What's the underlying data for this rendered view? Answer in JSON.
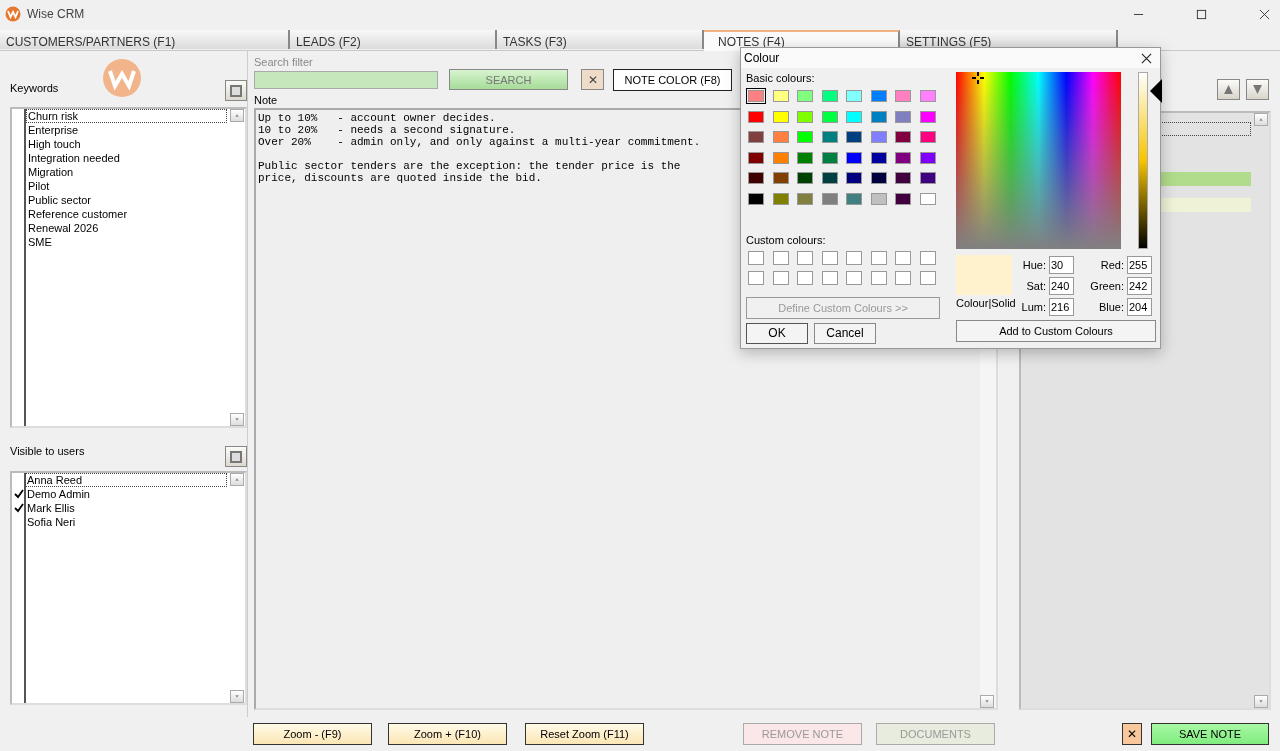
{
  "window": {
    "title": "Wise CRM"
  },
  "tabs": [
    {
      "label": "CUSTOMERS/PARTNERS (F1)",
      "selected": false
    },
    {
      "label": "LEADS (F2)",
      "selected": false
    },
    {
      "label": "TASKS (F3)",
      "selected": false
    },
    {
      "label": "NOTES (F4)",
      "selected": true
    },
    {
      "label": "SETTINGS (F5)",
      "selected": false
    }
  ],
  "keywords": {
    "label": "Keywords",
    "items": [
      {
        "label": "Churn risk",
        "focused": true
      },
      {
        "label": "Enterprise",
        "focused": false
      },
      {
        "label": "High touch",
        "focused": false
      },
      {
        "label": "Integration needed",
        "focused": false
      },
      {
        "label": "Migration",
        "focused": false
      },
      {
        "label": "Pilot",
        "focused": false
      },
      {
        "label": "Public sector",
        "focused": false
      },
      {
        "label": "Reference customer",
        "focused": false
      },
      {
        "label": "Renewal 2026",
        "focused": false
      },
      {
        "label": "SME",
        "focused": false
      }
    ]
  },
  "visible_users": {
    "label": "Visible to users",
    "items": [
      {
        "label": "Anna Reed",
        "checked": false,
        "focused": true
      },
      {
        "label": "Demo Admin",
        "checked": true,
        "focused": false
      },
      {
        "label": "Mark Ellis",
        "checked": true,
        "focused": false
      },
      {
        "label": "Sofia Neri",
        "checked": false,
        "focused": false
      }
    ]
  },
  "search": {
    "label": "Search filter",
    "button": "SEARCH",
    "clear": "✕",
    "color_button": "NOTE COLOR (F8)"
  },
  "note": {
    "label": "Note",
    "text": "Up to 10%   - account owner decides.\n10 to 20%   - needs a second signature.\nOver 20%    - admin only, and only against a multi-year commitment.\n\nPublic sector tenders are the exception: the tender price is the\nprice, discounts are quoted inside the bid."
  },
  "right_list": {
    "rows": [
      {
        "color": "#e3e3e3",
        "focused": true
      },
      {
        "color": "#b0dc8c",
        "focused": false
      },
      {
        "color": "#eff2d6",
        "focused": false
      }
    ]
  },
  "bottom_buttons": [
    {
      "label": "Zoom - (F9)",
      "kind": "zoom",
      "disabled": false
    },
    {
      "label": "Zoom + (F10)",
      "kind": "zoom",
      "disabled": false
    },
    {
      "label": "Reset Zoom (F11)",
      "kind": "zoom",
      "disabled": false
    },
    {
      "label": "REMOVE NOTE",
      "kind": "remove",
      "disabled": true
    },
    {
      "label": "DOCUMENTS",
      "kind": "documents",
      "disabled": true
    },
    {
      "label": "✕",
      "kind": "cancel",
      "disabled": false
    },
    {
      "label": "SAVE NOTE",
      "kind": "save",
      "disabled": false
    }
  ],
  "colour_dialog": {
    "title": "Colour",
    "basic_label": "Basic colours:",
    "basic": [
      {
        "color": "#ff8080",
        "selected": true
      },
      {
        "color": "#ffff80",
        "selected": false
      },
      {
        "color": "#80ff80",
        "selected": false
      },
      {
        "color": "#00ff80",
        "selected": false
      },
      {
        "color": "#80ffff",
        "selected": false
      },
      {
        "color": "#0080ff",
        "selected": false
      },
      {
        "color": "#ff80c0",
        "selected": false
      },
      {
        "color": "#ff80ff",
        "selected": false
      },
      {
        "color": "#ff0000",
        "selected": false
      },
      {
        "color": "#ffff00",
        "selected": false
      },
      {
        "color": "#80ff00",
        "selected": false
      },
      {
        "color": "#00ff40",
        "selected": false
      },
      {
        "color": "#00ffff",
        "selected": false
      },
      {
        "color": "#0080c0",
        "selected": false
      },
      {
        "color": "#8080c0",
        "selected": false
      },
      {
        "color": "#ff00ff",
        "selected": false
      },
      {
        "color": "#804040",
        "selected": false
      },
      {
        "color": "#ff8040",
        "selected": false
      },
      {
        "color": "#00ff00",
        "selected": false
      },
      {
        "color": "#008080",
        "selected": false
      },
      {
        "color": "#004080",
        "selected": false
      },
      {
        "color": "#8080ff",
        "selected": false
      },
      {
        "color": "#800040",
        "selected": false
      },
      {
        "color": "#ff0080",
        "selected": false
      },
      {
        "color": "#800000",
        "selected": false
      },
      {
        "color": "#ff8000",
        "selected": false
      },
      {
        "color": "#008000",
        "selected": false
      },
      {
        "color": "#008040",
        "selected": false
      },
      {
        "color": "#0000ff",
        "selected": false
      },
      {
        "color": "#0000a0",
        "selected": false
      },
      {
        "color": "#800080",
        "selected": false
      },
      {
        "color": "#8000ff",
        "selected": false
      },
      {
        "color": "#400000",
        "selected": false
      },
      {
        "color": "#804000",
        "selected": false
      },
      {
        "color": "#004000",
        "selected": false
      },
      {
        "color": "#004040",
        "selected": false
      },
      {
        "color": "#000080",
        "selected": false
      },
      {
        "color": "#000040",
        "selected": false
      },
      {
        "color": "#400040",
        "selected": false
      },
      {
        "color": "#400080",
        "selected": false
      },
      {
        "color": "#000000",
        "selected": false
      },
      {
        "color": "#808000",
        "selected": false
      },
      {
        "color": "#808040",
        "selected": false
      },
      {
        "color": "#808080",
        "selected": false
      },
      {
        "color": "#408080",
        "selected": false
      },
      {
        "color": "#c0c0c0",
        "selected": false
      },
      {
        "color": "#400040",
        "selected": false
      },
      {
        "color": "#ffffff",
        "selected": false
      }
    ],
    "custom_label": "Custom colours:",
    "define_button": {
      "label": "Define Custom Colours >>",
      "disabled": true
    },
    "ok": "OK",
    "cancel": "Cancel",
    "lum_slider": {
      "level": 0.9
    },
    "solid_label": "Colour|Solid",
    "hsl_fields": [
      {
        "label": "Hue:",
        "value": "30"
      },
      {
        "label": "Sat:",
        "value": "240"
      },
      {
        "label": "Lum:",
        "value": "216"
      }
    ],
    "rgb_fields": [
      {
        "label": "Red:",
        "value": "255"
      },
      {
        "label": "Green:",
        "value": "242"
      },
      {
        "label": "Blue:",
        "value": "204"
      }
    ],
    "add_button": "Add to Custom Colours"
  }
}
